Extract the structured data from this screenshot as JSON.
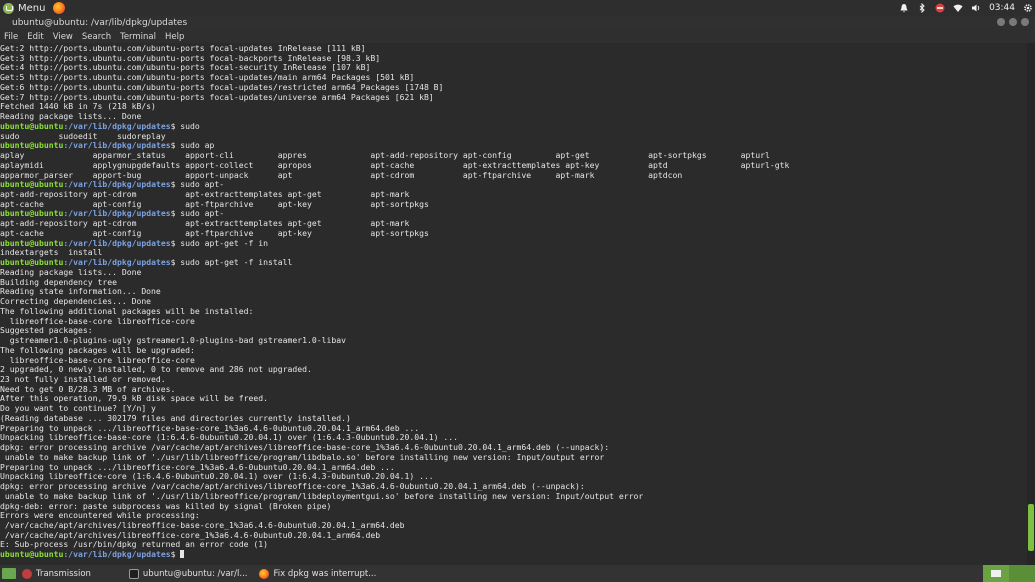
{
  "top_panel": {
    "menu_label": "Menu",
    "clock": "03:44"
  },
  "window": {
    "title": "ubuntu@ubuntu: /var/lib/dpkg/updates"
  },
  "menubar": {
    "items": [
      "File",
      "Edit",
      "View",
      "Search",
      "Terminal",
      "Help"
    ]
  },
  "terminal": {
    "prompt_user": "ubuntu@ubuntu",
    "prompt_path": ":/var/lib/dpkg/updates",
    "lines": [
      {
        "text": "Get:2 http://ports.ubuntu.com/ubuntu-ports focal-updates InRelease [111 kB]"
      },
      {
        "text": "Get:3 http://ports.ubuntu.com/ubuntu-ports focal-backports InRelease [98.3 kB]"
      },
      {
        "text": "Get:4 http://ports.ubuntu.com/ubuntu-ports focal-security InRelease [107 kB]"
      },
      {
        "text": "Get:5 http://ports.ubuntu.com/ubuntu-ports focal-updates/main arm64 Packages [501 kB]"
      },
      {
        "text": "Get:6 http://ports.ubuntu.com/ubuntu-ports focal-updates/restricted arm64 Packages [1748 B]"
      },
      {
        "text": "Get:7 http://ports.ubuntu.com/ubuntu-ports focal-updates/universe arm64 Packages [621 kB]"
      },
      {
        "text": "Fetched 1440 kB in 7s (218 kB/s)"
      },
      {
        "text": "Reading package lists... Done"
      },
      {
        "prompt": true,
        "text": "$ sudo"
      },
      {
        "text": "sudo        sudoedit    sudoreplay"
      },
      {
        "prompt": true,
        "text": "$ sudo ap"
      },
      {
        "text": "aplay              apparmor_status    apport-cli         appres             apt-add-repository apt-config         apt-get            apt-sortpkgs       apturl"
      },
      {
        "text": "aplaymidi          applygnupgdefaults apport-collect     apropos            apt-cache          apt-extracttemplates apt-key          aptd               apturl-gtk"
      },
      {
        "text": "apparmor_parser    apport-bug         apport-unpack      apt                apt-cdrom          apt-ftparchive     apt-mark           aptdcon"
      },
      {
        "prompt": true,
        "text": "$ sudo apt-"
      },
      {
        "text": "apt-add-repository apt-cdrom          apt-extracttemplates apt-get          apt-mark"
      },
      {
        "text": "apt-cache          apt-config         apt-ftparchive     apt-key            apt-sortpkgs"
      },
      {
        "prompt": true,
        "text": "$ sudo apt-"
      },
      {
        "text": "apt-add-repository apt-cdrom          apt-extracttemplates apt-get          apt-mark"
      },
      {
        "text": "apt-cache          apt-config         apt-ftparchive     apt-key            apt-sortpkgs"
      },
      {
        "prompt": true,
        "text": "$ sudo apt-get -f in"
      },
      {
        "text": "indextargets  install"
      },
      {
        "prompt": true,
        "text": "$ sudo apt-get -f install"
      },
      {
        "text": "Reading package lists... Done"
      },
      {
        "text": "Building dependency tree"
      },
      {
        "text": "Reading state information... Done"
      },
      {
        "text": "Correcting dependencies... Done"
      },
      {
        "text": "The following additional packages will be installed:"
      },
      {
        "text": "  libreoffice-base-core libreoffice-core"
      },
      {
        "text": "Suggested packages:"
      },
      {
        "text": "  gstreamer1.0-plugins-ugly gstreamer1.0-plugins-bad gstreamer1.0-libav"
      },
      {
        "text": "The following packages will be upgraded:"
      },
      {
        "text": "  libreoffice-base-core libreoffice-core"
      },
      {
        "text": "2 upgraded, 0 newly installed, 0 to remove and 286 not upgraded."
      },
      {
        "text": "23 not fully installed or removed."
      },
      {
        "text": "Need to get 0 B/28.3 MB of archives."
      },
      {
        "text": "After this operation, 79.9 kB disk space will be freed."
      },
      {
        "text": "Do you want to continue? [Y/n] y"
      },
      {
        "text": "(Reading database ... 302179 files and directories currently installed.)"
      },
      {
        "text": "Preparing to unpack .../libreoffice-base-core_1%3a6.4.6-0ubuntu0.20.04.1_arm64.deb ..."
      },
      {
        "text": "Unpacking libreoffice-base-core (1:6.4.6-0ubuntu0.20.04.1) over (1:6.4.3-0ubuntu0.20.04.1) ..."
      },
      {
        "text": "dpkg: error processing archive /var/cache/apt/archives/libreoffice-base-core_1%3a6.4.6-0ubuntu0.20.04.1_arm64.deb (--unpack):"
      },
      {
        "text": " unable to make backup link of './usr/lib/libreoffice/program/libdbalo.so' before installing new version: Input/output error"
      },
      {
        "text": "Preparing to unpack .../libreoffice-core_1%3a6.4.6-0ubuntu0.20.04.1_arm64.deb ..."
      },
      {
        "text": "Unpacking libreoffice-core (1:6.4.6-0ubuntu0.20.04.1) over (1:6.4.3-0ubuntu0.20.04.1) ..."
      },
      {
        "text": "dpkg: error processing archive /var/cache/apt/archives/libreoffice-core_1%3a6.4.6-0ubuntu0.20.04.1_arm64.deb (--unpack):"
      },
      {
        "text": " unable to make backup link of './usr/lib/libreoffice/program/libdeploymentgui.so' before installing new version: Input/output error"
      },
      {
        "text": "dpkg-deb: error: paste subprocess was killed by signal (Broken pipe)"
      },
      {
        "text": "Errors were encountered while processing:"
      },
      {
        "text": " /var/cache/apt/archives/libreoffice-base-core_1%3a6.4.6-0ubuntu0.20.04.1_arm64.deb"
      },
      {
        "text": " /var/cache/apt/archives/libreoffice-core_1%3a6.4.6-0ubuntu0.20.04.1_arm64.deb"
      },
      {
        "text": "E: Sub-process /usr/bin/dpkg returned an error code (1)"
      },
      {
        "prompt": true,
        "text": "$ ",
        "cursor": true
      }
    ],
    "scroll_position": 0.97,
    "scroll_visible_fraction": 0.09
  },
  "taskbar": {
    "tasks": [
      {
        "name": "transmission",
        "label": "Transmission",
        "icon": "transmission-icon"
      },
      {
        "name": "terminal",
        "label": "ubuntu@ubuntu: /var/l...",
        "icon": "terminal-icon"
      },
      {
        "name": "firefox",
        "label": "Fix dpkg was interrupt...",
        "icon": "firefox-icon"
      }
    ]
  },
  "colors": {
    "prompt_user": "#8ae234",
    "prompt_path": "#7ba3e3",
    "accent": "#7fbf44"
  }
}
